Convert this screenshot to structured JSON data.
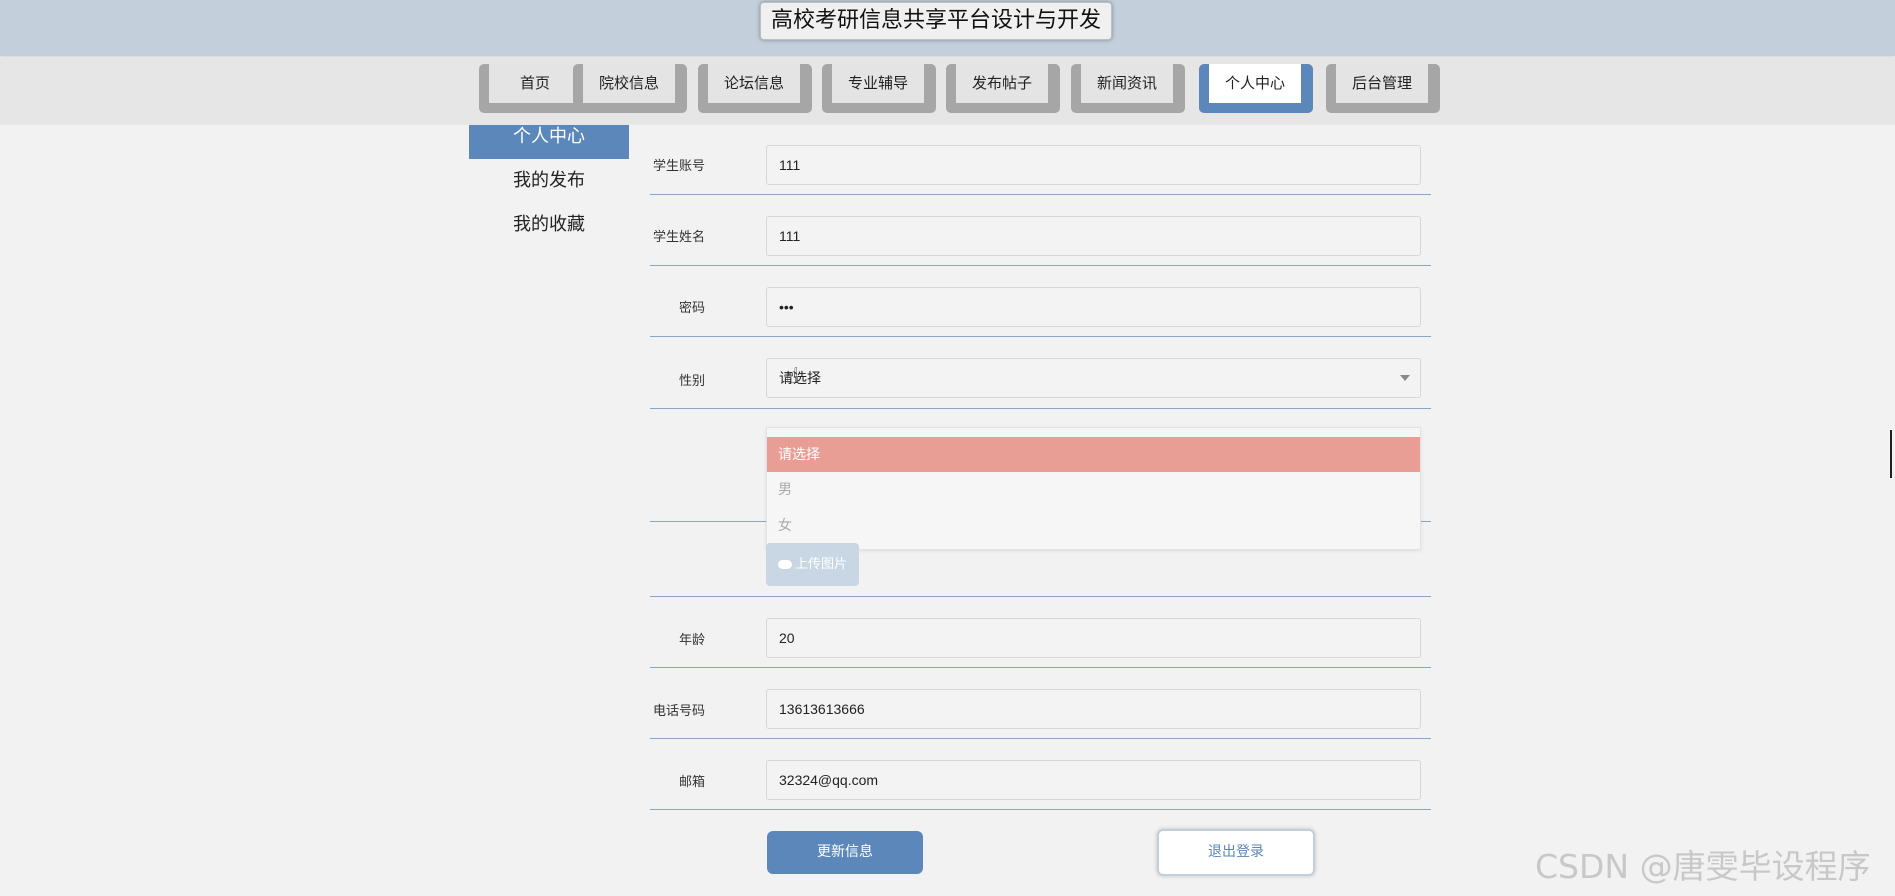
{
  "header": {
    "title": "高校考研信息共享平台设计与开发"
  },
  "nav": {
    "items": [
      {
        "label": "首页"
      },
      {
        "label": "院校信息"
      },
      {
        "label": "论坛信息"
      },
      {
        "label": "专业辅导"
      },
      {
        "label": "发布帖子"
      },
      {
        "label": "新闻资讯"
      },
      {
        "label": "个人中心",
        "active": true
      },
      {
        "label": "后台管理"
      }
    ]
  },
  "sidebar": {
    "items": [
      {
        "label": "个人中心",
        "active": true
      },
      {
        "label": "我的发布"
      },
      {
        "label": "我的收藏"
      }
    ]
  },
  "form": {
    "account": {
      "label": "学生账号",
      "value": "111"
    },
    "name": {
      "label": "学生姓名",
      "value": "111"
    },
    "password": {
      "label": "密码",
      "value": "•••"
    },
    "gender": {
      "label": "性别",
      "value": "请选择",
      "options": [
        "请选择",
        "男",
        "女"
      ]
    },
    "upload_label": "上传图片",
    "age": {
      "label": "年龄",
      "value": "20"
    },
    "phone": {
      "label": "电话号码",
      "value": "13613613666"
    },
    "email": {
      "label": "邮箱",
      "value": "32324@qq.com"
    }
  },
  "actions": {
    "update_label": "更新信息",
    "logout_label": "退出登录"
  },
  "watermark": "CSDN @唐雯毕设程序",
  "colors": {
    "primary": "#5b87ba",
    "header_bg": "#c3cfdb",
    "selected_option": "#e89e94"
  }
}
